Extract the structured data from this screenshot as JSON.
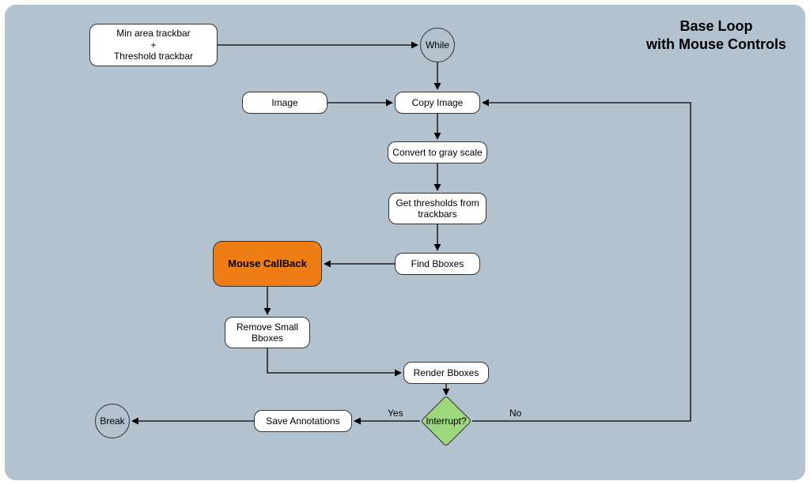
{
  "title_line1": "Base Loop",
  "title_line2": "with Mouse Controls",
  "nodes": {
    "trackbars": {
      "line1": "Min area trackbar",
      "line2": "+",
      "line3": "Threshold trackbar"
    },
    "while": "While",
    "image": "Image",
    "copy_image": "Copy Image",
    "gray": "Convert to gray scale",
    "thresholds": {
      "line1": "Get thresholds from",
      "line2": "trackbars"
    },
    "find_bboxes": "Find Bboxes",
    "callback": "Mouse CallBack",
    "remove_small": {
      "line1": "Remove Small",
      "line2": "Bboxes"
    },
    "render": "Render Bboxes",
    "decision": "Interrupt?",
    "save": "Save Annotations",
    "break": "Break"
  },
  "edge_labels": {
    "yes": "Yes",
    "no": "No"
  },
  "chart_data": {
    "type": "flowchart",
    "title": "Base Loop with Mouse Controls",
    "nodes": [
      {
        "id": "trackbars",
        "label": "Min area trackbar + Threshold trackbar",
        "shape": "rounded-rect"
      },
      {
        "id": "while",
        "label": "While",
        "shape": "circle"
      },
      {
        "id": "image",
        "label": "Image",
        "shape": "rounded-rect"
      },
      {
        "id": "copy_image",
        "label": "Copy Image",
        "shape": "rounded-rect"
      },
      {
        "id": "gray",
        "label": "Convert to gray scale",
        "shape": "rounded-rect"
      },
      {
        "id": "thresholds",
        "label": "Get thresholds from trackbars",
        "shape": "rounded-rect"
      },
      {
        "id": "find_bboxes",
        "label": "Find Bboxes",
        "shape": "rounded-rect"
      },
      {
        "id": "callback",
        "label": "Mouse CallBack",
        "shape": "rounded-rect",
        "highlight": true
      },
      {
        "id": "remove_small",
        "label": "Remove Small Bboxes",
        "shape": "rounded-rect"
      },
      {
        "id": "render",
        "label": "Render Bboxes",
        "shape": "rounded-rect"
      },
      {
        "id": "decision",
        "label": "Interrupt?",
        "shape": "diamond"
      },
      {
        "id": "save",
        "label": "Save Annotations",
        "shape": "rounded-rect"
      },
      {
        "id": "break",
        "label": "Break",
        "shape": "circle"
      }
    ],
    "edges": [
      {
        "from": "trackbars",
        "to": "while"
      },
      {
        "from": "while",
        "to": "copy_image"
      },
      {
        "from": "image",
        "to": "copy_image"
      },
      {
        "from": "copy_image",
        "to": "gray"
      },
      {
        "from": "gray",
        "to": "thresholds"
      },
      {
        "from": "thresholds",
        "to": "find_bboxes"
      },
      {
        "from": "find_bboxes",
        "to": "callback"
      },
      {
        "from": "callback",
        "to": "remove_small"
      },
      {
        "from": "remove_small",
        "to": "render"
      },
      {
        "from": "render",
        "to": "decision"
      },
      {
        "from": "decision",
        "to": "save",
        "label": "Yes"
      },
      {
        "from": "save",
        "to": "break"
      },
      {
        "from": "decision",
        "to": "copy_image",
        "label": "No"
      }
    ]
  }
}
